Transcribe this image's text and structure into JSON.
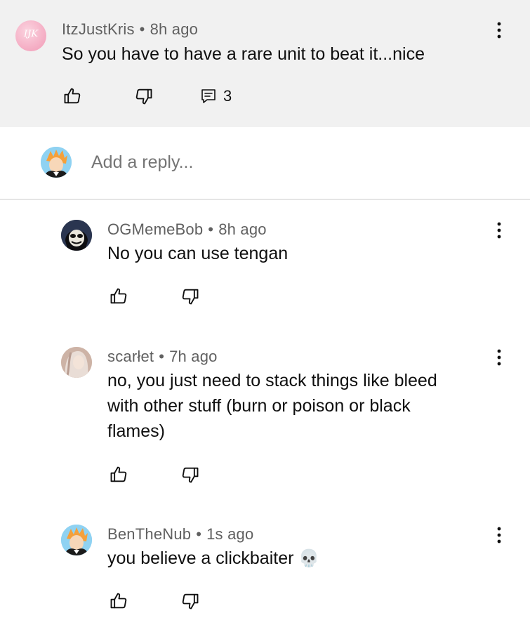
{
  "parent_comment": {
    "avatar_initials": "IJK",
    "author": "ItzJustKris",
    "separator": "•",
    "time": "8h ago",
    "text": "So you have to have a rare unit to beat it...nice",
    "reply_count": "3"
  },
  "reply_box": {
    "placeholder": "Add a reply..."
  },
  "replies": [
    {
      "author": "OGMemeBob",
      "separator": "•",
      "time": "8h ago",
      "lines": [
        "No you can use tengan"
      ]
    },
    {
      "author": "scarłet",
      "separator": "•",
      "time": "7h ago",
      "lines": [
        "no, you just need to stack things like bleed",
        "with other stuff (burn or poison or black",
        "flames)"
      ]
    },
    {
      "author": "BenTheNub",
      "separator": "•",
      "time": "1s ago",
      "lines": [
        "you believe a clickbaiter"
      ],
      "emoji": "💀"
    }
  ],
  "colors": {
    "parent_background": "#f1f1f1",
    "meta_text": "#606060",
    "text": "#0f0f0f",
    "avatar_pink": "#f5a8c0"
  },
  "icons": [
    "like-icon",
    "dislike-icon",
    "reply-icon",
    "more-vert-icon",
    "skull-emoji"
  ]
}
